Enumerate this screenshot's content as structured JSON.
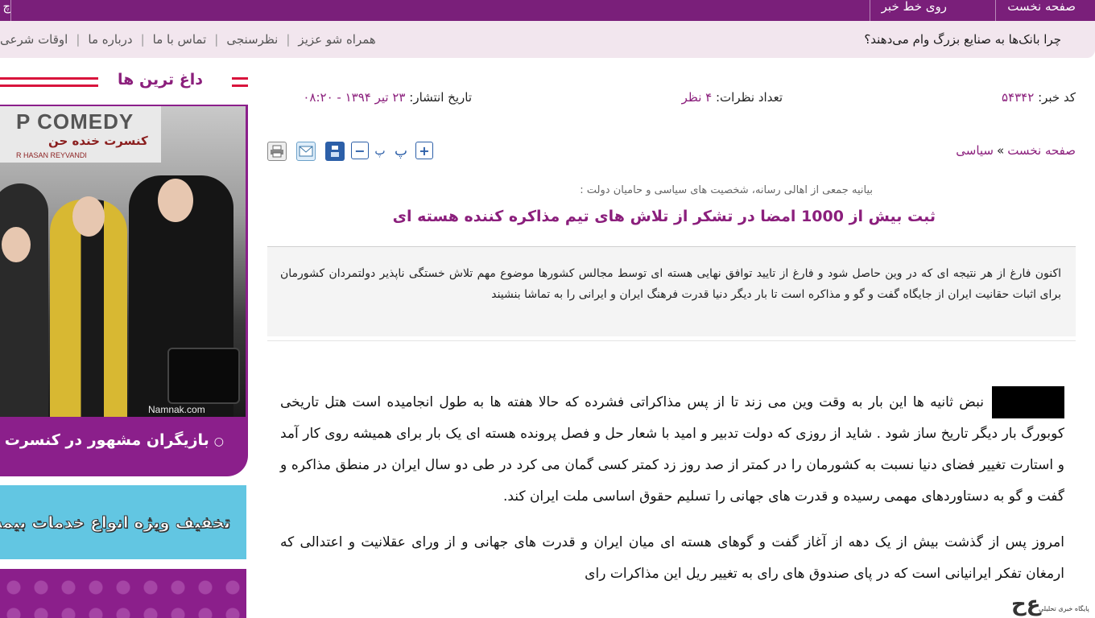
{
  "topbar": {
    "home_label": "صفحه نخست",
    "ticker_label": "روی خط خبر",
    "left_cut": "چ"
  },
  "subbar": {
    "headline": "چرا بانک‌ها به صنایع بزرگ وام می‌دهند؟",
    "links": [
      "همراه شو عزیز",
      "نظرسنجی",
      "تماس با ما",
      "درباره ما",
      "اوقات شرعی"
    ]
  },
  "sidebar": {
    "title": "داغ ترین ها",
    "promo": {
      "banner_text": "P COMEDY",
      "banner_sub": "کنسرت خنده حن",
      "banner_name": "R HASAN REYVANDI",
      "watermark": "Namnak.com",
      "caption": "بازیگران مشهور در کنسرت",
      "bullet": "○"
    },
    "promo2_text": "تخفیف ویژه انواع خدمات بیمه"
  },
  "meta": {
    "code_label": "کد خبر:",
    "code_value": "۵۴۳۴۲",
    "comments_label": "تعداد نظرات:",
    "comments_value": "۴ نظر",
    "date_label": "تاریخ انتشار:",
    "date_value": "۲۳ تیر ۱۳۹۴ - ۰۸:۲۰"
  },
  "breadcrumb": {
    "home": "صفحه نخست",
    "sep": "»",
    "section": "سیاسی"
  },
  "tools": {
    "small_font": "پ",
    "big_font": "پ",
    "minus": "−",
    "plus": "+"
  },
  "article": {
    "overline": "بیانیه جمعی از اهالی رسانه، شخصیت های سیاسی و حامیان دولت :",
    "title": "ثبت بیش از 1000 امضا در تشکر از تلاش های تیم مذاکره کننده هسته ای",
    "lead": "اکنون فارغ از هر نتیجه ای که در وین حاصل شود و فارغ از تایید توافق نهایی هسته ای توسط مجالس کشورها موضوع مهم تلاش خستگی ناپذیر دولتمردان کشورمان برای اثبات حقانیت ایران از جایگاه گفت و گو و مذاکره است تا بار دیگر دنیا قدرت فرهنگ ایران و ایرانی را به تماشا بنشیند",
    "para1": "نبض ثانیه ها این بار به وقت وین می زند تا از پس مذاکراتی فشرده که حالا هفته ها به طول انجامیده است هتل تاریخی کوبورگ بار دیگر تاریخ ساز شود . شاید از روزی که دولت تدبیر و امید با شعار حل و فصل پرونده هسته ای یک بار برای همیشه روی کار آمد و استارت تغییر فضای دنیا نسبت به کشورمان را در کمتر از صد روز زد کمتر کسی گمان می کرد در طی دو سال ایران در منطق مذاکره و گفت و گو به دستاوردهای مهمی رسیده و قدرت های جهانی را تسلیم حقوق اساسی ملت ایران کند.",
    "para2": "امروز پس از گذشت بیش از یک دهه از آغاز گفت و گوهای هسته ای میان ایران و قدرت های جهانی و از ورای عقلانیت و اعتدالی که ارمغان تفکر ایرانیانی است که در پای صندوق های رای به تغییر ریل این مذاکرات رای"
  },
  "corner_logo": {
    "mark": "ع‌ح",
    "small": "پایگاه خبری تحلیلی"
  },
  "colors": {
    "brand_purple": "#7a1f7a",
    "accent_red": "#d9143c",
    "link_purple": "#8b1f7c"
  }
}
